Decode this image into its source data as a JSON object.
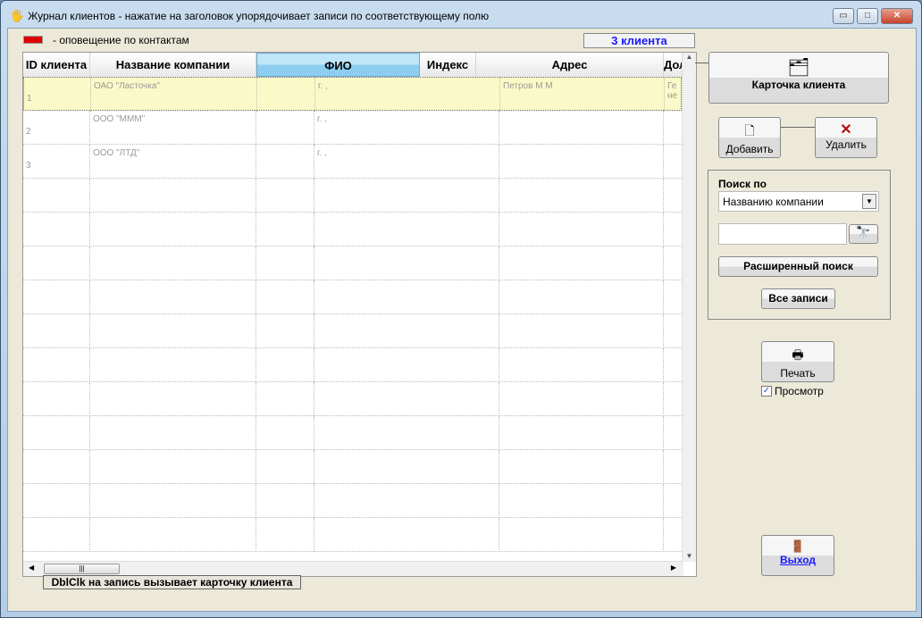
{
  "window": {
    "title": "Журнал клиентов - нажатие на заголовок упорядочивает записи по соответствующему полю",
    "minimize": "▭",
    "maximize": "□",
    "close": "✕"
  },
  "legend": {
    "color": "#e00000",
    "text": "- оповещение по контактам"
  },
  "count": "3 клиента",
  "columns": [
    "ID клиента",
    "Название компании",
    "ФИО",
    "Индекс",
    "Адрес",
    "Дол"
  ],
  "rows": [
    {
      "id": "1",
      "company": "ОАО \"Ласточка\"",
      "c3": "г. ,",
      "c4": "Петров М М",
      "c5": "Ге не"
    },
    {
      "id": "2",
      "company": "ООО \"МММ\"",
      "c3": "г. ,",
      "c4": "",
      "c5": ""
    },
    {
      "id": "3",
      "company": "ООО \"ЛТД\"",
      "c3": "г. ,",
      "c4": "",
      "c5": ""
    }
  ],
  "buttons": {
    "card": "Карточка клиента",
    "add": "Добавить",
    "delete": "Удалить",
    "advanced": "Расширенный поиск",
    "all": "Все записи",
    "print": "Печать",
    "exit": "Выход"
  },
  "search": {
    "label": "Поиск по",
    "field": "Названию компании",
    "value": ""
  },
  "preview": {
    "label": "Просмотр",
    "checked": true
  },
  "hint": "DblClk на запись вызывает карточку клиента"
}
